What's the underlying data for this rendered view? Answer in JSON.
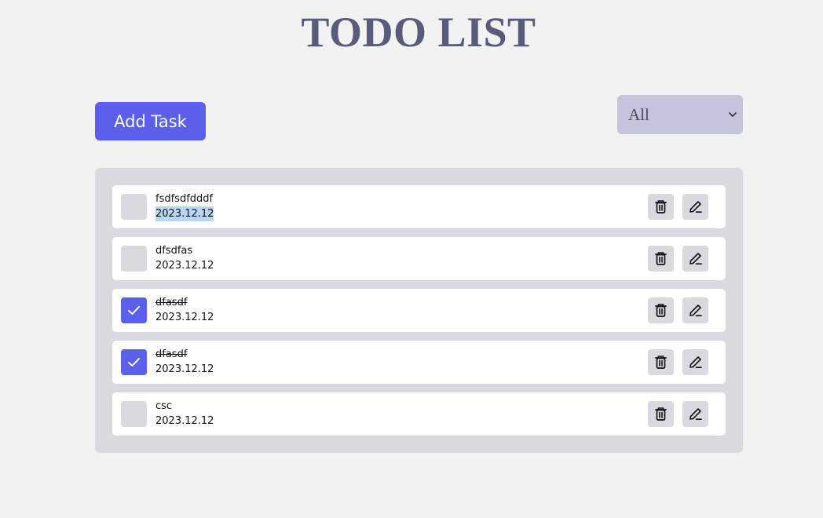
{
  "header": {
    "title": "TODO LIST"
  },
  "toolbar": {
    "add_task_label": "Add Task",
    "filter": {
      "selected": "All",
      "options": [
        "All"
      ]
    }
  },
  "tasks": [
    {
      "title": "fsdfsdfdddf",
      "date": "2023.12.12",
      "completed": false,
      "date_selected": true
    },
    {
      "title": "dfsdfas",
      "date": "2023.12.12",
      "completed": false,
      "date_selected": false
    },
    {
      "title": "dfasdf",
      "date": "2023.12.12",
      "completed": true,
      "date_selected": false
    },
    {
      "title": "dfasdf",
      "date": "2023.12.12",
      "completed": true,
      "date_selected": false
    },
    {
      "title": "csc",
      "date": "2023.12.12",
      "completed": false,
      "date_selected": false
    }
  ],
  "icons": {
    "delete": "trash-icon",
    "edit": "pencil-icon",
    "check": "check-icon",
    "dropdown": "chevron-down-icon"
  },
  "colors": {
    "accent": "#5b60ea",
    "title": "#585b7b",
    "filter_bg": "#c4c5dc",
    "panel_bg": "#d9dadf",
    "page_bg": "#f2f2f2",
    "selection": "#b8d6f4"
  }
}
